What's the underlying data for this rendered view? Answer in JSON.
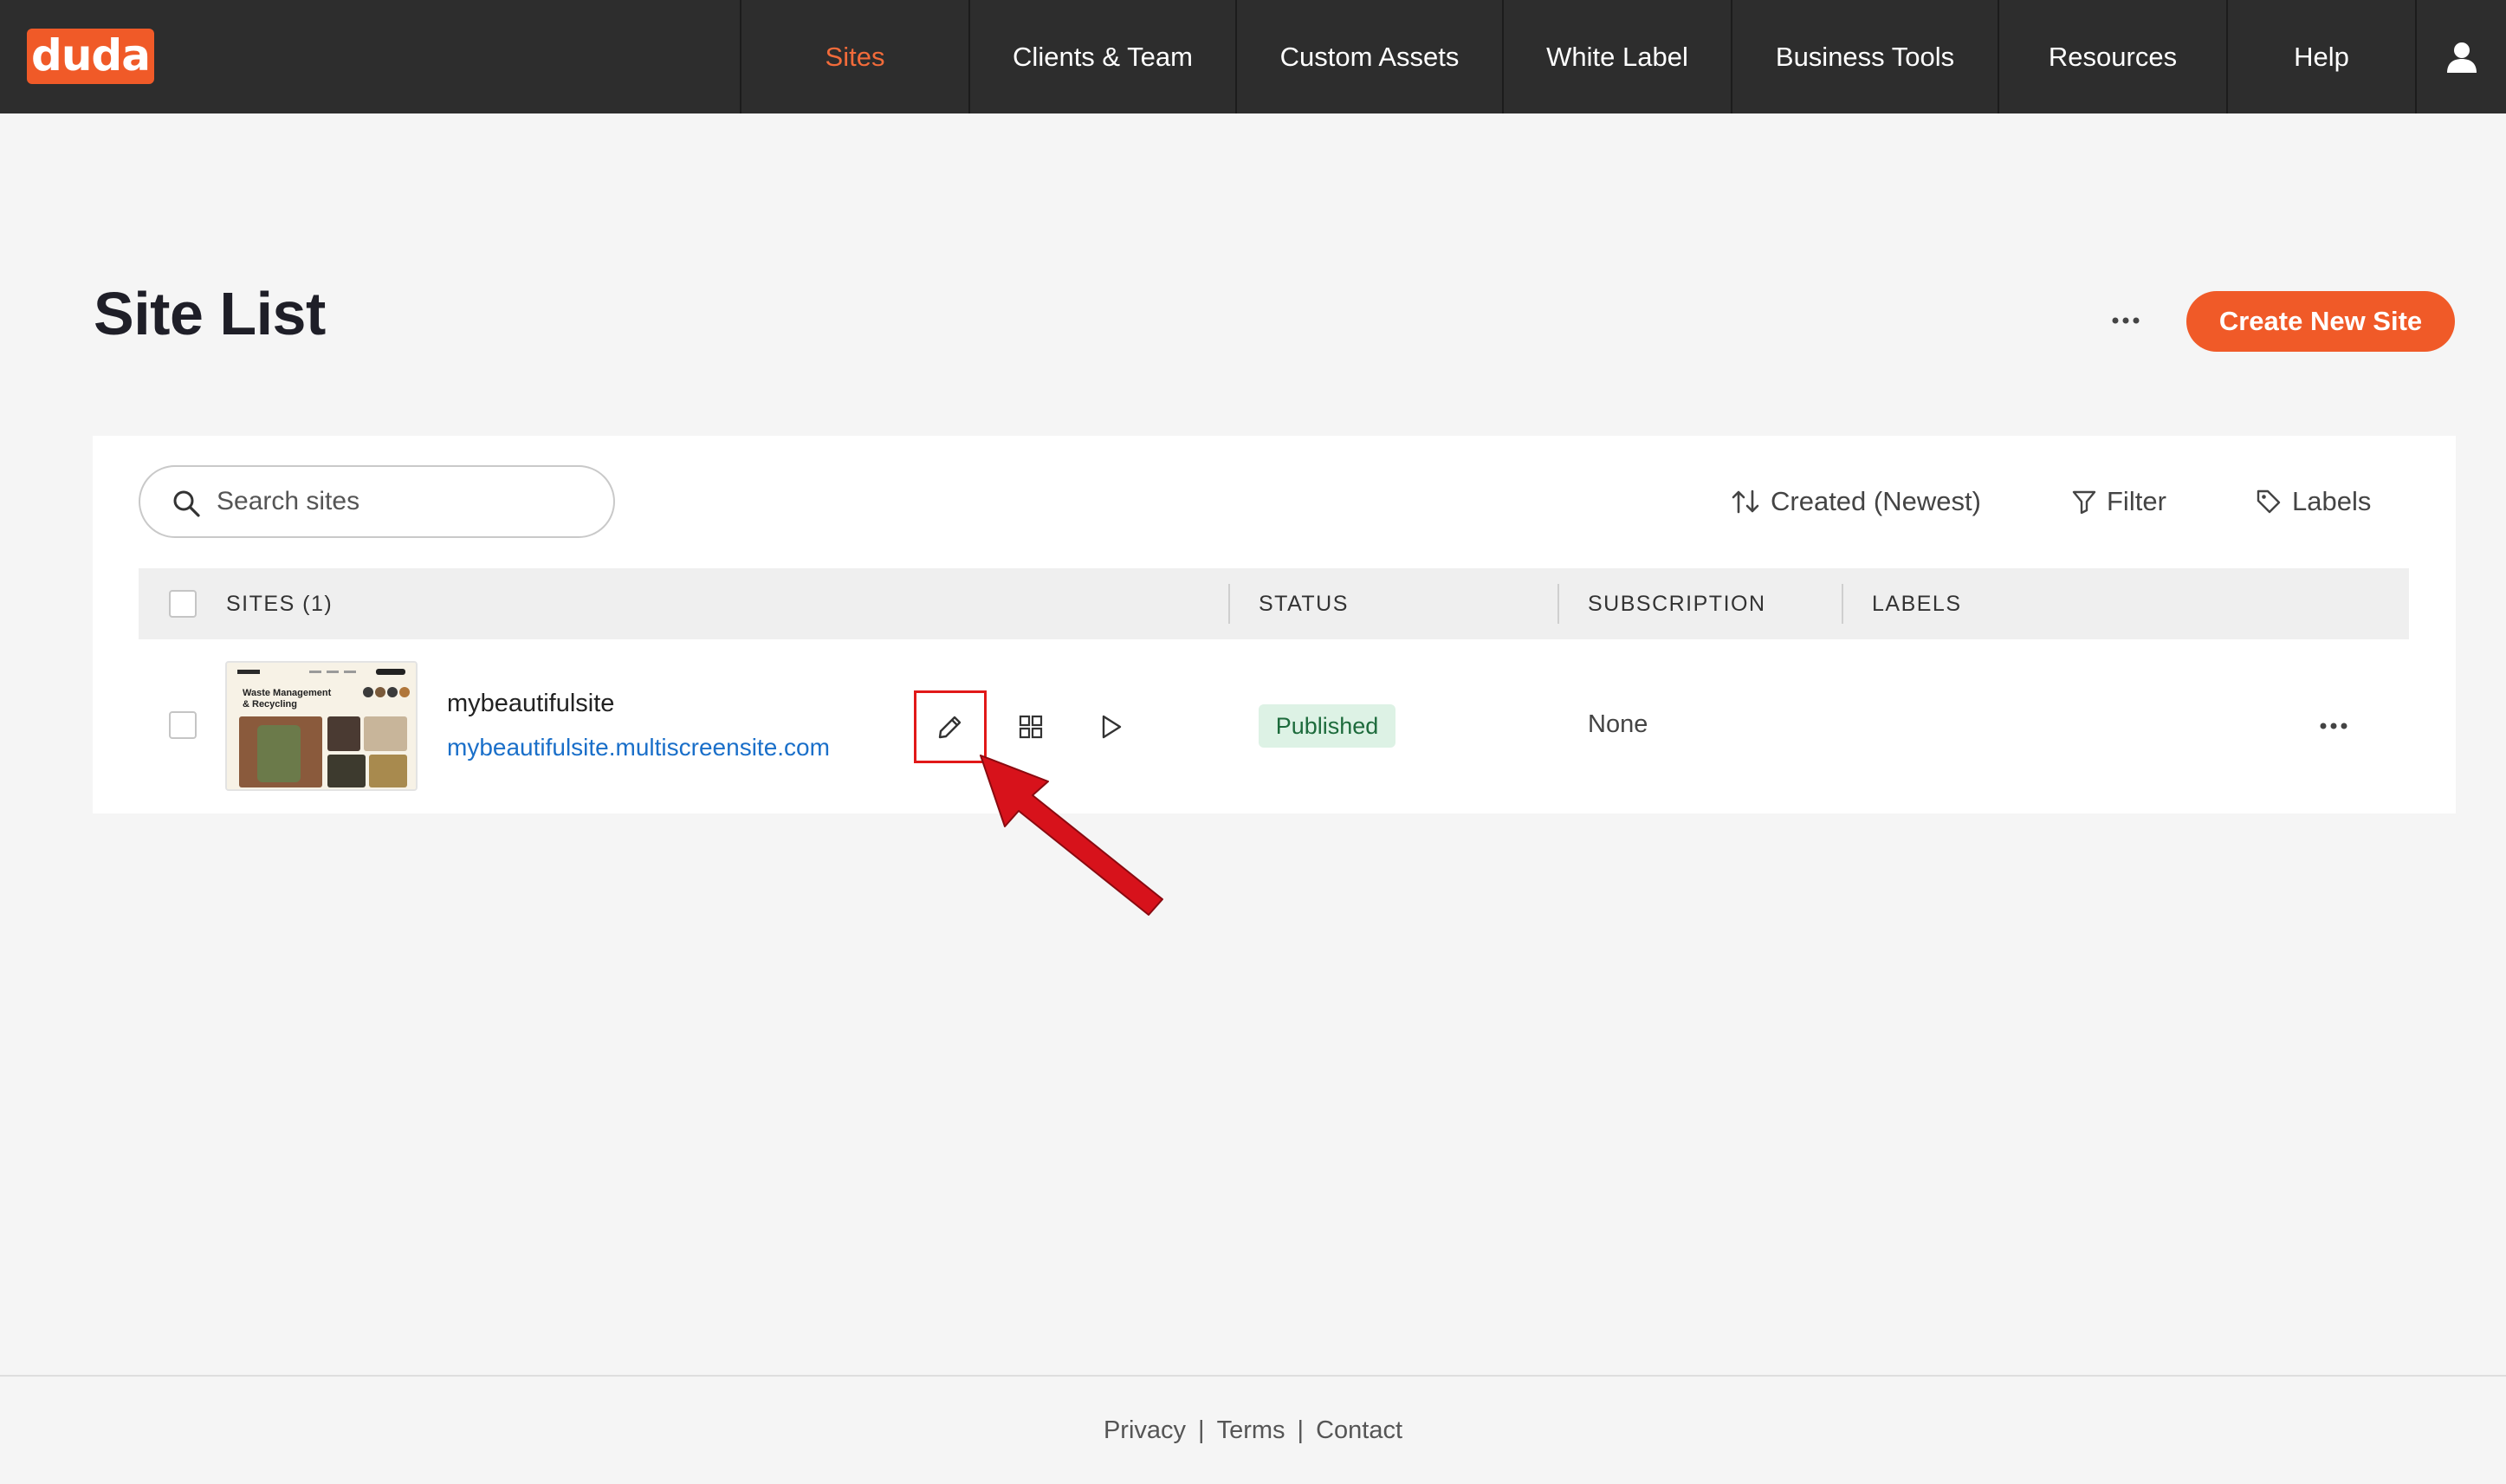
{
  "brand": {
    "logo_text": "duda",
    "accent": "#f05a28"
  },
  "nav": {
    "items": [
      {
        "label": "Sites",
        "active": true
      },
      {
        "label": "Clients & Team"
      },
      {
        "label": "Custom Assets"
      },
      {
        "label": "White Label"
      },
      {
        "label": "Business Tools"
      },
      {
        "label": "Resources"
      },
      {
        "label": "Help"
      }
    ],
    "user_icon": "user-icon"
  },
  "page": {
    "title": "Site List",
    "more_icon": "more-horizontal-icon",
    "create_button": "Create New Site"
  },
  "toolbar": {
    "search_placeholder": "Search sites",
    "sort_label": "Created (Newest)",
    "filter_label": "Filter",
    "labels_label": "Labels"
  },
  "table": {
    "columns": [
      "SITES (1)",
      "STATUS",
      "SUBSCRIPTION",
      "LABELS"
    ],
    "rows": [
      {
        "name": "mybeautifulsite",
        "url": "mybeautifulsite.multiscreensite.com",
        "thumbnail_heading": "Waste Management & Recycling",
        "status": "Published",
        "subscription": "None",
        "labels": "",
        "actions": [
          "edit-pencil-icon",
          "widgets-grid-icon",
          "preview-play-icon"
        ]
      }
    ]
  },
  "footer": {
    "links": [
      "Privacy",
      "Terms",
      "Contact"
    ]
  },
  "colors": {
    "status_published_bg": "#ddf2e5",
    "status_published_text": "#1d6b3c",
    "link": "#1a6fc9",
    "annotation": "#e11818"
  }
}
